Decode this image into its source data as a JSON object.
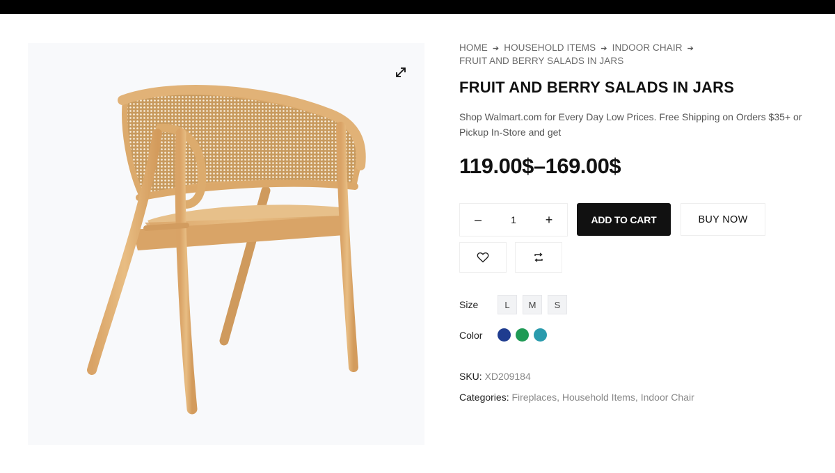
{
  "breadcrumb": {
    "home": "HOME",
    "household": "HOUSEHOLD ITEMS",
    "indoor": "INDOOR CHAIR",
    "current": "FRUIT AND BERRY SALADS IN JARS",
    "separator_icon": "arrow-right-icon"
  },
  "product": {
    "title": "FRUIT AND BERRY SALADS IN JARS",
    "description": "Shop Walmart.com for Every Day Low Prices. Free Shipping on Orders $35+ or Pickup In-Store and get",
    "price": "119.00$–169.00$"
  },
  "cart": {
    "decrement": "–",
    "quantity": "1",
    "increment": "+",
    "add_to_cart": "ADD TO CART",
    "buy_now": "BUY NOW"
  },
  "actions": {
    "wishlist_icon": "heart-icon",
    "compare_icon": "compare-arrows-icon"
  },
  "options": {
    "size_label": "Size",
    "sizes": [
      "L",
      "M",
      "S"
    ],
    "color_label": "Color",
    "colors": [
      "#1f3c8f",
      "#1f9a55",
      "#2a9bad"
    ]
  },
  "meta": {
    "sku_label": "SKU:",
    "sku_value": "XD209184",
    "categories_label": "Categories:",
    "categories": [
      "Fireplaces",
      "Household Items",
      "Indoor Chair"
    ]
  },
  "gallery": {
    "zoom_icon": "expand-icon",
    "image": "rattan-chair"
  }
}
